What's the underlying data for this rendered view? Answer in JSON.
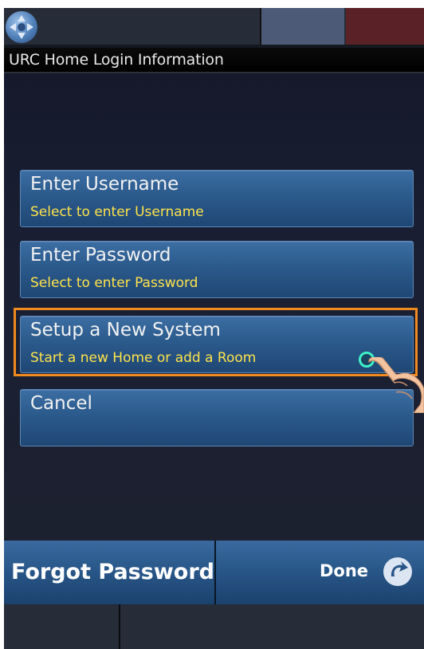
{
  "title_bar": {
    "title": "URC Home Login Information"
  },
  "menu": {
    "items": [
      {
        "label": "Enter Username",
        "sublabel": "Select to enter Username"
      },
      {
        "label": "Enter Password",
        "sublabel": "Select to enter Password"
      },
      {
        "label": "Setup a New System",
        "sublabel": "Start a new Home or add a Room",
        "highlighted": true
      },
      {
        "label": "Cancel",
        "sublabel": ""
      }
    ]
  },
  "bottom": {
    "forgot_label": "Forgot Password",
    "done_label": "Done",
    "done_icon": "refresh-arrow-icon"
  },
  "colors": {
    "button_blue": "#2b5a8c",
    "sublabel_yellow": "#ffe34a",
    "highlight_orange": "#f08a1e",
    "top_tile_blue": "#4d5a77",
    "top_tile_red": "#5a2227"
  }
}
